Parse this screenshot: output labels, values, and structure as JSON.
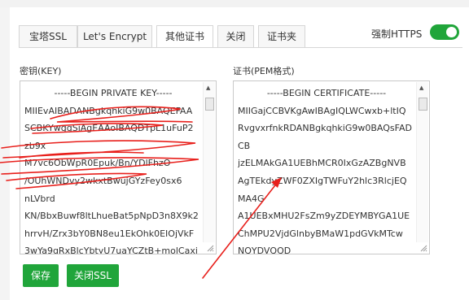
{
  "tabs": [
    {
      "label": "宝塔SSL"
    },
    {
      "label": "Let's Encrypt"
    },
    {
      "label": "其他证书"
    },
    {
      "label": "关闭"
    },
    {
      "label": "证书夹"
    }
  ],
  "https_toggle": {
    "label": "强制HTTPS",
    "enabled": true
  },
  "key_field": {
    "label": "密钥(KEY)",
    "lines": [
      "-----BEGIN PRIVATE KEY-----",
      "MIIEvAIBADANBgkqhkiG9w0BAQEFAA",
      "SCBKYwggSiAgEAAoIBAQDTpL1uFuP2",
      "zb9x",
      "M7vc6ObWpR0Epuk/Bn/YDlFhzO",
      "/OUhWNDvy2wkxtBwujGYzFey0sx6",
      "nLVbrd",
      "KN/BbxBuwf8ltLhueBat5pNpD3n8X9k2",
      "hrrvH/Zrx3bY0BN8eu1EkOhk0EIOjVkF",
      "3wYa9qRxBlcYbtyU7uaYCZtB+molCaxj"
    ]
  },
  "cert_field": {
    "label": "证书(PEM格式)",
    "lines": [
      "-----BEGIN CERTIFICATE-----",
      "MIIGajCCBVKgAwIBAgIQLWCwxb+ltIQ",
      "RvgvxrfnkRDANBgkqhkiG9w0BAQsFAD",
      "CB",
      "jzELMAkGA1UEBhMCR0IxGzAZBgNVB",
      "AgTEkdyZWF0ZXIgTWFuY2hlc3RlcjEQ",
      "MA4G",
      "A1UEBxMHU2FsZm9yZDEYMBYGA1UE",
      "ChMPU2VjdGlnbyBMaW1pdGVkMTcw",
      "NQYDVQQD"
    ]
  },
  "buttons": {
    "save": "保存",
    "close_ssl": "关闭SSL"
  },
  "colors": {
    "accent": "#20a53a",
    "annotation": "#e8201c"
  }
}
